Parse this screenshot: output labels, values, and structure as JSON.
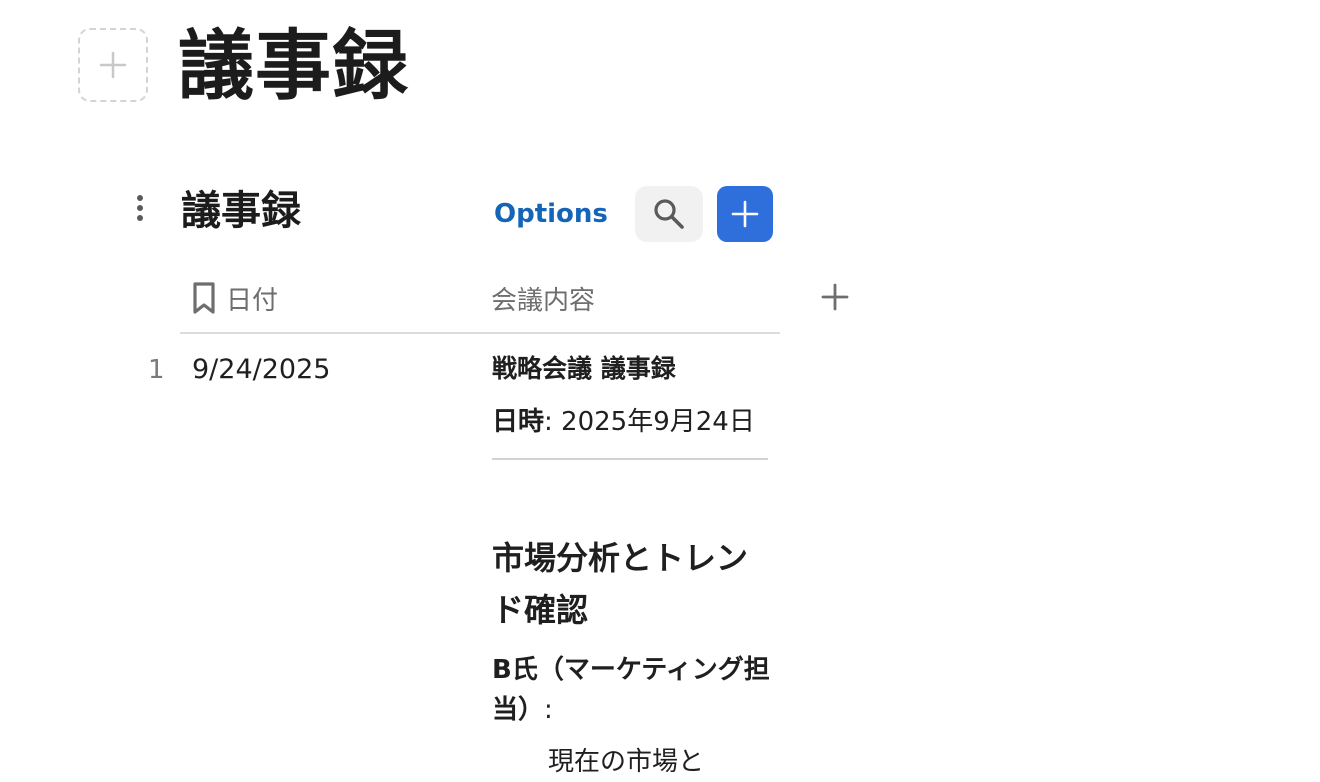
{
  "page": {
    "title": "議事録"
  },
  "database": {
    "title": "議事録",
    "options_label": "Options",
    "columns": [
      {
        "label": "日付",
        "icon": "bookmark-icon"
      },
      {
        "label": "会議内容"
      }
    ],
    "rows": [
      {
        "number": "1",
        "date": "9/24/2025",
        "content": {
          "heading": "戦略会議 議事録",
          "datetime_label": "日時",
          "datetime_sep": ":",
          "datetime_value": "2025年9月24日",
          "section_heading": "市場分析とトレンド確認",
          "speaker_label": "B氏（マーケティング担当）",
          "speaker_sep": ":",
          "bullet_text": "現在の市場と"
        }
      }
    ]
  },
  "colors": {
    "accent_blue": "#2f6fdb",
    "link_blue": "#1464b8"
  }
}
